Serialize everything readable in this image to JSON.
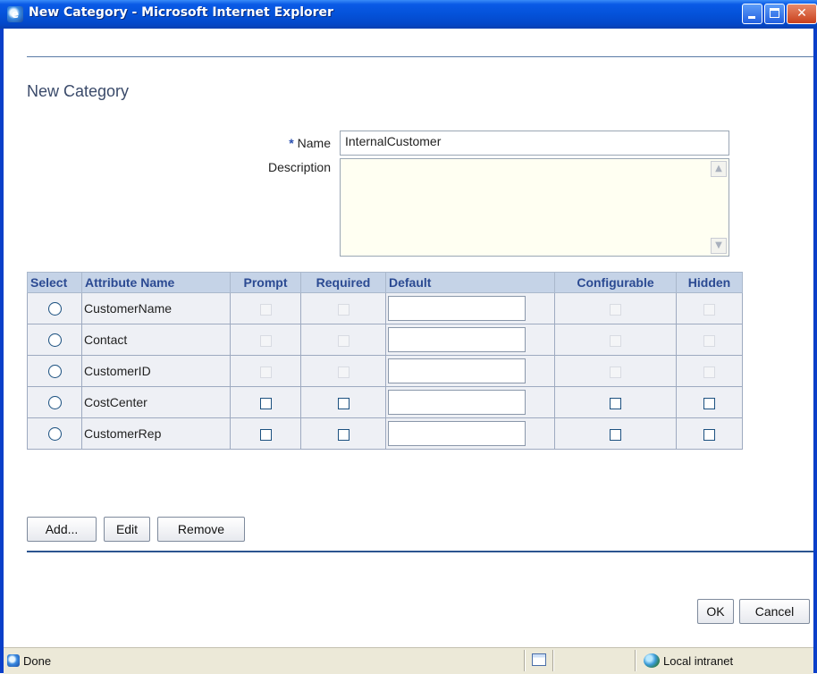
{
  "window": {
    "title": "New Category - Microsoft Internet Explorer",
    "min_label": "",
    "max_label": "",
    "close_label": "✕"
  },
  "page": {
    "title": "New Category"
  },
  "form": {
    "name_required_marker": "*",
    "name_label": "Name",
    "name_value": "InternalCustomer",
    "description_label": "Description",
    "description_value": ""
  },
  "table": {
    "headers": {
      "select": "Select",
      "attribute_name": "Attribute Name",
      "prompt": "Prompt",
      "required": "Required",
      "default": "Default",
      "configurable": "Configurable",
      "hidden": "Hidden"
    },
    "rows": [
      {
        "name": "CustomerName",
        "enabled": false
      },
      {
        "name": "Contact",
        "enabled": false
      },
      {
        "name": "CustomerID",
        "enabled": false
      },
      {
        "name": "CostCenter",
        "enabled": true
      },
      {
        "name": "CustomerRep",
        "enabled": true
      }
    ]
  },
  "buttons": {
    "add": "Add...",
    "edit": "Edit",
    "remove": "Remove",
    "ok": "OK",
    "cancel": "Cancel"
  },
  "statusbar": {
    "status": "Done",
    "zone": "Local intranet"
  },
  "colors": {
    "titlebar": "#0452d9",
    "header_bg": "#c5d3e7",
    "header_text": "#2b4a92",
    "cell_bg": "#eef0f5",
    "rule": "#2c5490"
  },
  "icons": {
    "app": "ie-icon",
    "page": "page-icon",
    "zone": "local-intranet-icon"
  }
}
